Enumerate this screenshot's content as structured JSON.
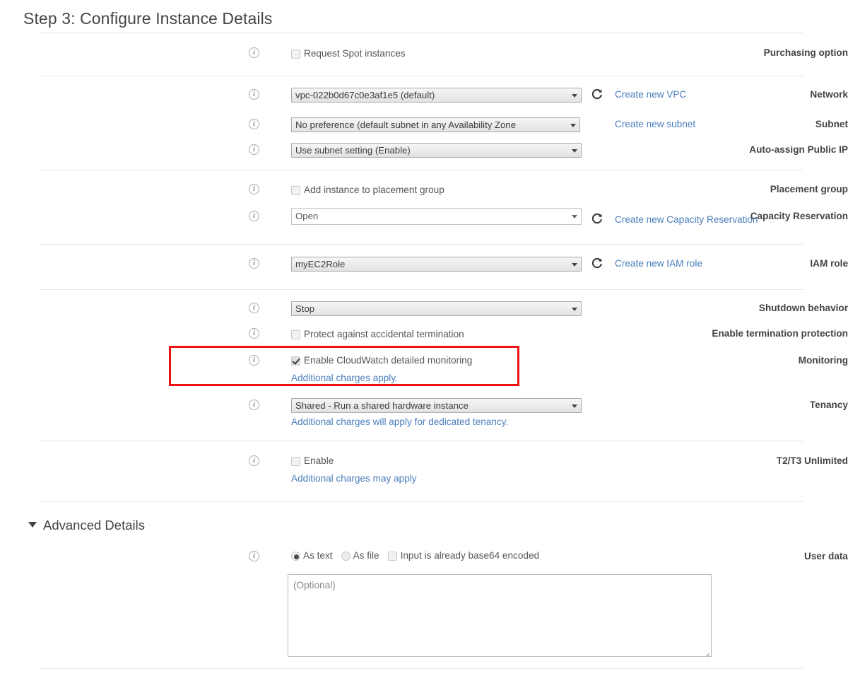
{
  "page": {
    "title": "Step 3: Configure Instance Details",
    "advanced_details_label": "Advanced Details"
  },
  "icons": {
    "info": "i",
    "refresh": "refresh-icon",
    "caret_down": "chevron-down-icon",
    "triangle_expanded": "triangle-down-icon",
    "resize_grip": "resize-handle-icon"
  },
  "colors": {
    "link": "#4a7ebb",
    "highlight_box": "#ee1111",
    "label_text": "#444444",
    "divider": "#e7e7e7"
  },
  "fields": {
    "purchasing_option": {
      "label": "Purchasing option",
      "checkbox_label": "Request Spot instances",
      "checked": false
    },
    "network": {
      "label": "Network",
      "value": "vpc-022b0d67c0e3af1e5 (default)",
      "link": "Create new VPC",
      "has_refresh": true
    },
    "subnet": {
      "label": "Subnet",
      "value": "No preference (default subnet in any Availability Zone",
      "link": "Create new subnet",
      "has_refresh": false
    },
    "auto_assign_public_ip": {
      "label": "Auto-assign Public IP",
      "value": "Use subnet setting (Enable)"
    },
    "placement_group": {
      "label": "Placement group",
      "checkbox_label": "Add instance to placement group",
      "checked": false
    },
    "capacity_reservation": {
      "label": "Capacity Reservation",
      "value": "Open",
      "link": "Create new Capacity Reservation",
      "has_refresh": true
    },
    "iam_role": {
      "label": "IAM role",
      "value": "myEC2Role",
      "link": "Create new IAM role",
      "has_refresh": true
    },
    "shutdown_behavior": {
      "label": "Shutdown behavior",
      "value": "Stop"
    },
    "termination_protection": {
      "label": "Enable termination protection",
      "checkbox_label": "Protect against accidental termination",
      "checked": false
    },
    "monitoring": {
      "label": "Monitoring",
      "checkbox_label": "Enable CloudWatch detailed monitoring",
      "checked": true,
      "note": "Additional charges apply.",
      "highlighted": true
    },
    "tenancy": {
      "label": "Tenancy",
      "value": "Shared - Run a shared hardware instance",
      "note": "Additional charges will apply for dedicated tenancy."
    },
    "t2_t3_unlimited": {
      "label": "T2/T3 Unlimited",
      "checkbox_label": "Enable",
      "checked": false,
      "note": "Additional charges may apply"
    },
    "user_data": {
      "label": "User data",
      "option_as_text": "As text",
      "option_as_file": "As file",
      "option_base64": "Input is already base64 encoded",
      "selected_mode": "As text",
      "base64_checked": false,
      "textarea_placeholder": "(Optional)",
      "textarea_value": ""
    }
  }
}
